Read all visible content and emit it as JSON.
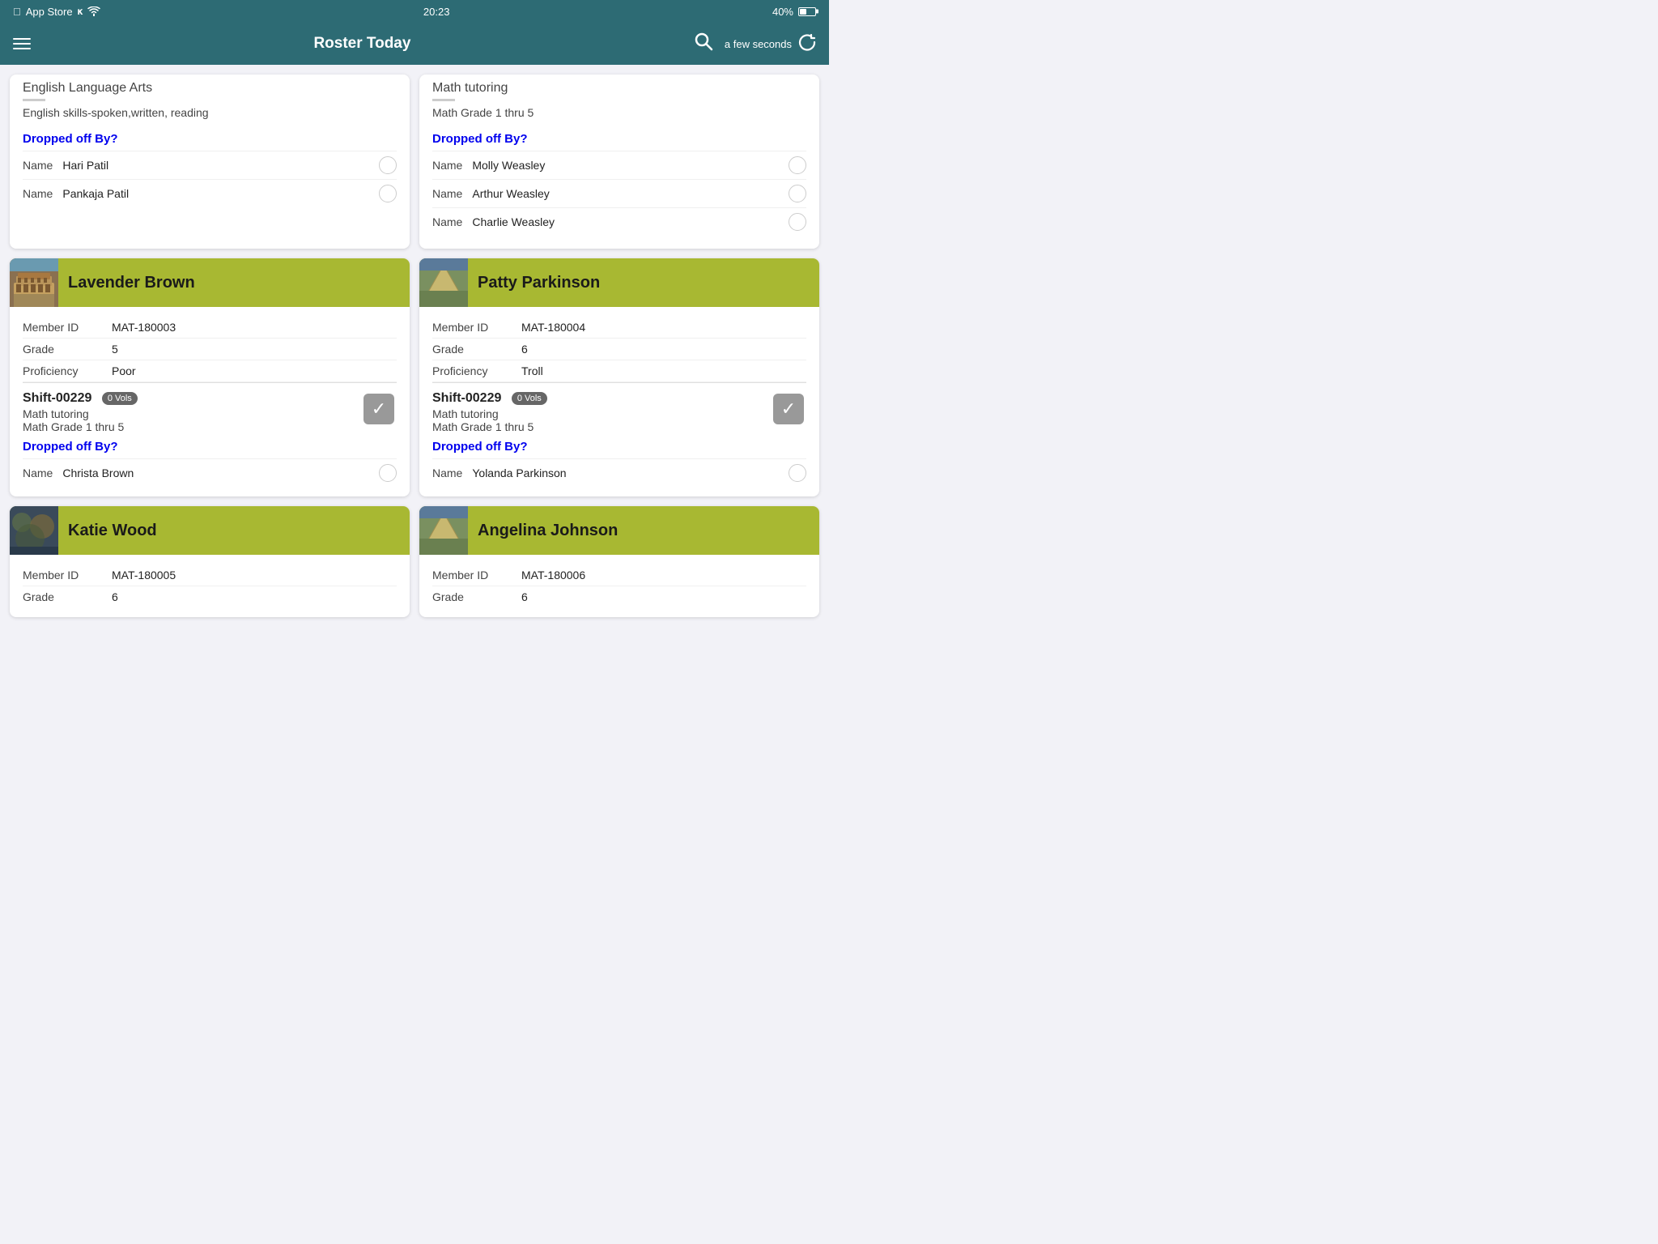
{
  "statusBar": {
    "appName": "App Store",
    "time": "20:23",
    "batteryPercent": "40%",
    "wifiSymbol": "wifi"
  },
  "navBar": {
    "title": "Roster Today",
    "refreshTime": "a few seconds"
  },
  "partialCards": [
    {
      "id": "partial-left",
      "subject": "English Language Arts",
      "description": "English skills-spoken,written, reading",
      "droppedByLabel": "Dropped off By?",
      "names": [
        {
          "label": "Name",
          "value": "Hari Patil"
        },
        {
          "label": "Name",
          "value": "Pankaja Patil"
        }
      ]
    },
    {
      "id": "partial-right",
      "subject": "Math tutoring",
      "description": "Math Grade 1 thru 5",
      "droppedByLabel": "Dropped off By?",
      "names": [
        {
          "label": "Name",
          "value": "Molly Weasley"
        },
        {
          "label": "Name",
          "value": "Arthur Weasley"
        },
        {
          "label": "Name",
          "value": "Charlie Weasley"
        }
      ]
    }
  ],
  "studentCards": [
    {
      "id": "lavender-brown",
      "name": "Lavender Brown",
      "imgType": "colosseum",
      "memberId": "MAT-180003",
      "grade": "5",
      "proficiency": "Poor",
      "shift": {
        "id": "Shift-00229",
        "vols": "0 Vols",
        "subject": "Math tutoring",
        "grade": "Math Grade 1 thru 5",
        "checked": true
      },
      "droppedByLabel": "Dropped off By?",
      "names": [
        {
          "label": "Name",
          "value": "Christa Brown"
        }
      ]
    },
    {
      "id": "patty-parkinson",
      "name": "Patty Parkinson",
      "imgType": "pyramid",
      "memberId": "MAT-180004",
      "grade": "6",
      "proficiency": "Troll",
      "shift": {
        "id": "Shift-00229",
        "vols": "0 Vols",
        "subject": "Math tutoring",
        "grade": "Math Grade 1 thru 5",
        "checked": true
      },
      "droppedByLabel": "Dropped off By?",
      "names": [
        {
          "label": "Name",
          "value": "Yolanda Parkinson"
        }
      ]
    },
    {
      "id": "katie-wood",
      "name": "Katie Wood",
      "imgType": "abstract",
      "memberId": "MAT-180005",
      "grade": "6",
      "proficiency": "",
      "shift": null,
      "droppedByLabel": "",
      "names": []
    },
    {
      "id": "angelina-johnson",
      "name": "Angelina Johnson",
      "imgType": "pyramid",
      "memberId": "MAT-180006",
      "grade": "6",
      "proficiency": "",
      "shift": null,
      "droppedByLabel": "",
      "names": []
    }
  ],
  "labels": {
    "memberId": "Member ID",
    "grade": "Grade",
    "proficiency": "Proficiency",
    "name": "Name",
    "droppedOffBy": "Dropped off By?"
  }
}
